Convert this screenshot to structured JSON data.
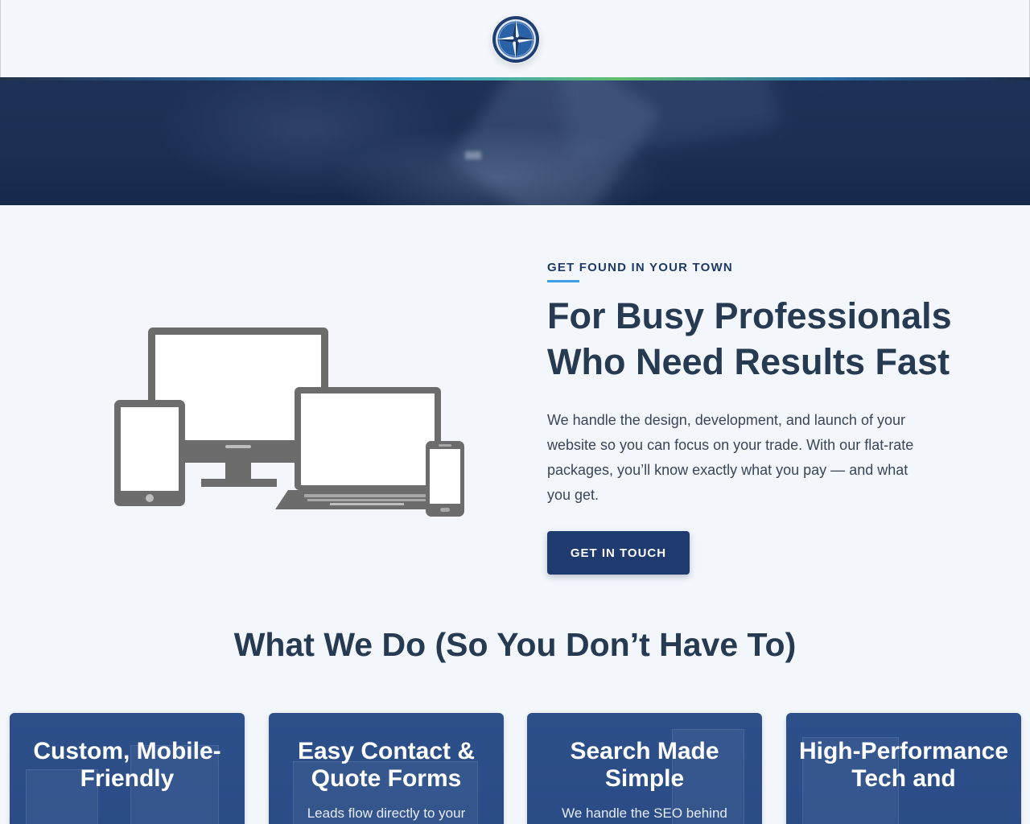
{
  "header": {
    "logo_icon": "compass-rose-icon",
    "colors": {
      "logo_outer": "#1f3f72",
      "logo_inner": "#2a62a8",
      "bar_accent": "#3a9fd6"
    }
  },
  "intro": {
    "eyebrow": "GET FOUND IN YOUR TOWN",
    "title": "For Busy Professionals Who Need Results Fast",
    "text": "We handle the design, development, and launch of your website so you can focus on your trade. With our flat-rate packages, you’ll know exactly what you pay — and what you get.",
    "cta_label": "GET IN TOUCH",
    "illustration_icon": "responsive-devices-icon"
  },
  "services": {
    "title": "What We Do (So You Don’t Have To)",
    "cards": [
      {
        "title": "Custom, Mobile-Friendly",
        "text": ""
      },
      {
        "title": "Easy Contact & Quote Forms",
        "text": "Leads flow directly to your"
      },
      {
        "title": "Search Made Simple",
        "text": "We handle the SEO behind"
      },
      {
        "title": "High-Performance Tech and",
        "text": ""
      }
    ]
  },
  "colors": {
    "primary": "#1f3a6e",
    "heading": "#263a52",
    "accent": "#3aa0e0",
    "card_bg": "#2d4f8a",
    "device_gray": "#6c6c6c"
  }
}
